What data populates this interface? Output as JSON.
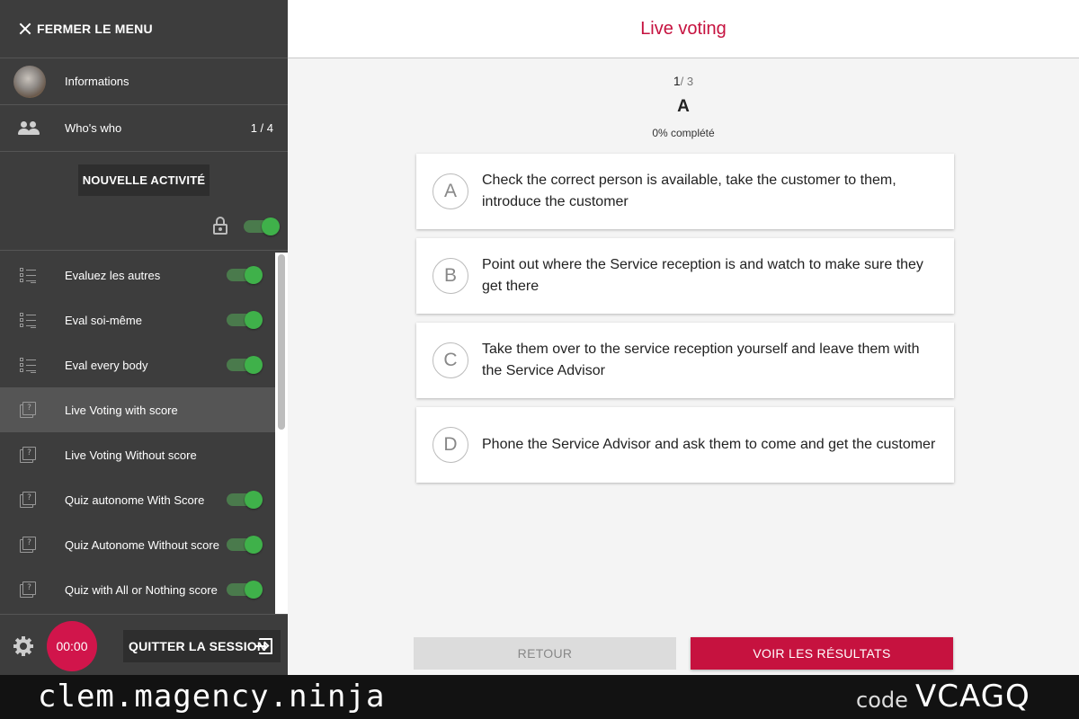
{
  "sidebar": {
    "close_label": "FERMER LE MENU",
    "informations_label": "Informations",
    "whoswho_label": "Who's who",
    "whoswho_count": "1 / 4",
    "new_activity_label": "NOUVELLE ACTIVITÉ",
    "lock_toggle_on": true,
    "activities": [
      {
        "label": "Evaluez les autres",
        "icon": "list-icon",
        "toggle": true,
        "selected": false
      },
      {
        "label": "Eval soi-même",
        "icon": "list-icon",
        "toggle": true,
        "selected": false
      },
      {
        "label": "Eval every body",
        "icon": "list-icon",
        "toggle": true,
        "selected": false
      },
      {
        "label": "Live Voting with score",
        "icon": "quiz-icon",
        "toggle": null,
        "selected": true
      },
      {
        "label": "Live Voting Without score",
        "icon": "quiz-icon",
        "toggle": null,
        "selected": false
      },
      {
        "label": "Quiz autonome With Score",
        "icon": "quiz-icon",
        "toggle": true,
        "selected": false
      },
      {
        "label": "Quiz Autonome Without score",
        "icon": "quiz-icon",
        "toggle": true,
        "selected": false
      },
      {
        "label": "Quiz with All or Nothing score",
        "icon": "quiz-icon",
        "toggle": true,
        "selected": false
      }
    ],
    "timer": "00:00",
    "quit_label": "QUITTER LA SESSION"
  },
  "header": {
    "title": "Live voting"
  },
  "question": {
    "current": "1",
    "total": "/ 3",
    "title": "A",
    "completion": "0% complété",
    "answers": [
      {
        "letter": "A",
        "text": "Check the correct person is available, take the customer to them, introduce the customer"
      },
      {
        "letter": "B",
        "text": "Point out where the Service reception is and watch to make sure they get there"
      },
      {
        "letter": "C",
        "text": "Take them over to the service reception yourself and leave them with the Service Advisor"
      },
      {
        "letter": "D",
        "text": "Phone the Service Advisor and ask them to come and get the customer"
      }
    ]
  },
  "actions": {
    "back_label": "RETOUR",
    "results_label": "VOIR LES RÉSULTATS"
  },
  "footer": {
    "site": "clem.magency.ninja",
    "code_label": "code",
    "code": "VCAGQ"
  },
  "colors": {
    "accent": "#c6123f",
    "sidebar_bg": "#3d3d3d",
    "toggle_on": "#3fb14a"
  }
}
